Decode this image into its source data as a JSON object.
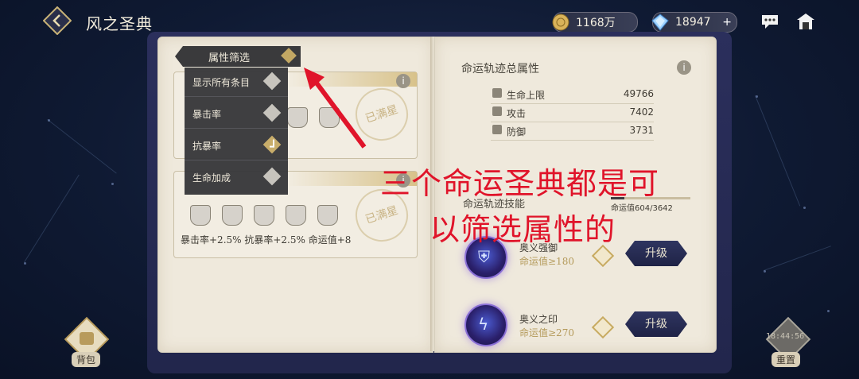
{
  "header": {
    "title": "风之圣典",
    "gold": "1168万",
    "gems": "18947",
    "gems_plus": "+"
  },
  "filter": {
    "title": "属性筛选",
    "items": [
      {
        "label": "显示所有条目",
        "checked": false
      },
      {
        "label": "暴击率",
        "checked": false
      },
      {
        "label": "抗暴率",
        "checked": true
      },
      {
        "label": "生命加成",
        "checked": false
      }
    ]
  },
  "left_page": {
    "cards": [
      {
        "seal": "已满星",
        "stats": ""
      },
      {
        "seal": "已满星",
        "stats": "暴击率+2.5% 抗暴率+2.5% 命运值+8"
      }
    ],
    "info": "i"
  },
  "right_page": {
    "title": "命运轨迹总属性",
    "info": "i",
    "stats": [
      {
        "name": "生命上限",
        "value": "49766",
        "icon": "heart-icon"
      },
      {
        "name": "攻击",
        "value": "7402",
        "icon": "sword-icon"
      },
      {
        "name": "防御",
        "value": "3731",
        "icon": "shield-icon"
      }
    ],
    "skills_title": "命运轨迹技能",
    "progress_label": "命运值604/3642",
    "progress_fraction": 0.166,
    "skills": [
      {
        "name": "奥义强御",
        "req": "命运值≥180",
        "button": "升级",
        "icon": "shield-rune-icon"
      },
      {
        "name": "奥义之印",
        "req": "命运值≥270",
        "button": "升级",
        "icon": "lightning-rune-icon"
      }
    ]
  },
  "overlay": {
    "line1": "三个命运圣典都是可",
    "line2": "以筛选属性的"
  },
  "bottom": {
    "bag_label": "背包",
    "reset_label": "重置",
    "timer": "18:44:56"
  },
  "colors": {
    "background": "#0f1a33",
    "page": "#efe9dc",
    "gold_accent": "#c8ad6a",
    "annotation_red": "#e0142a"
  }
}
